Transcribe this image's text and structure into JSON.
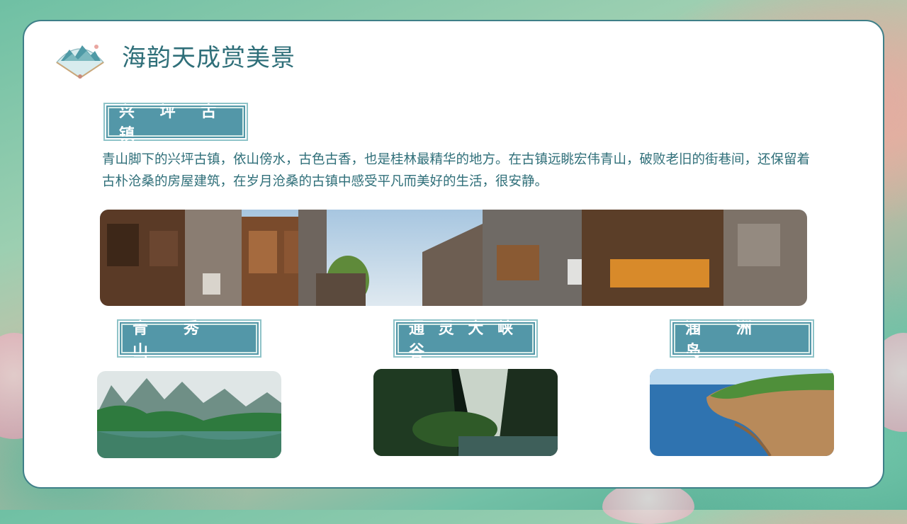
{
  "page": {
    "title": "海韵天成赏美景"
  },
  "main": {
    "section_tag": "兴 坪 古 镇",
    "description": "青山脚下的兴坪古镇，依山傍水，古色古香，也是桂林最精华的地方。在古镇远眺宏伟青山，破败老旧的街巷间，还保留着古朴沧桑的房屋建筑，在岁月沧桑的古镇中感受平凡而美好的生活，很安静。",
    "attractions": [
      {
        "label": "青　秀　山"
      },
      {
        "label": "通 灵 大 峡 谷"
      },
      {
        "label": "涠　洲　岛"
      }
    ]
  },
  "colors": {
    "accent": "#2f6f79",
    "tag_bg": "#5397a8",
    "card_bg": "#ffffff"
  }
}
